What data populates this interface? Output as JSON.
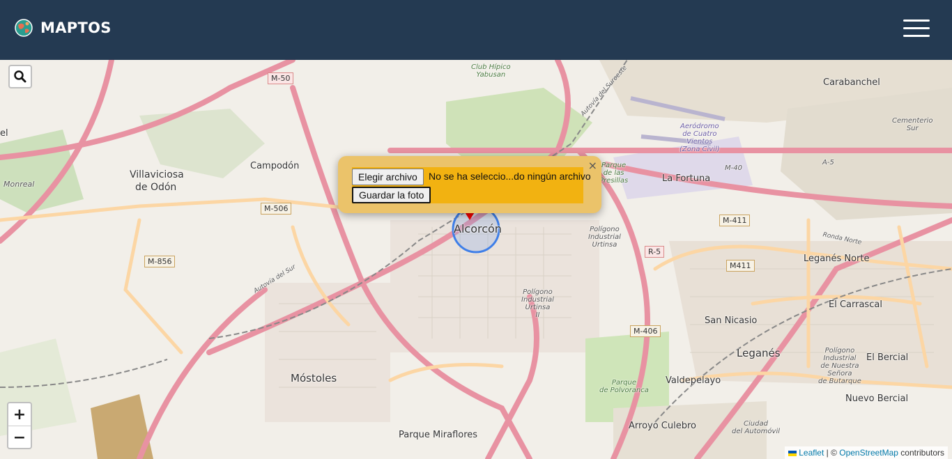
{
  "navbar": {
    "brand": "MAPTOS"
  },
  "map": {
    "places": {
      "alcorcon": "Alcorcón",
      "mostoles": "Móstoles",
      "leganes": "Leganés",
      "leganes_norte": "Leganés Norte",
      "carabanchel": "Carabanchel",
      "villaviciosa": "Villaviciosa",
      "de_odon": "de Odón",
      "campodon": "Campodón",
      "la_fortuna": "La Fortuna",
      "san_nicasio": "San Nicasio",
      "el_carrascal": "El Carrascal",
      "el_bercial": "El Bercial",
      "nuevo_bercial": "Nuevo Bercial",
      "valdepelayo": "Valdepelayo",
      "arroyo_culebro": "Arroyo Culebro",
      "parque_miraflores": "Parque Miraflores",
      "club_hipico_1": "Club Hípico",
      "club_hipico_2": "Yabusan",
      "aerodromo_1": "Aeródromo",
      "aerodromo_2": "de Cuatro",
      "aerodromo_3": "Vientos",
      "aerodromo_4": "(Zona Civil)",
      "cementerio_1": "Cementerio",
      "cementerio_2": "Sur",
      "poligono_urtinsa_1": "Polígono",
      "poligono_urtinsa_2": "Industrial",
      "poligono_urtinsa_3": "Urtinsa",
      "poligono_urtinsa2_1": "Polígono",
      "poligono_urtinsa2_2": "Industrial",
      "poligono_urtinsa2_3": "Urtinsa",
      "poligono_urtinsa2_4": "II",
      "poligono_butarque_1": "Polígono",
      "poligono_butarque_2": "Industrial",
      "poligono_butarque_3": "de Nuestra",
      "poligono_butarque_4": "Señora",
      "poligono_butarque_5": "de Butarque",
      "parque_presillas_1": "Parque",
      "parque_presillas_2": "de las",
      "parque_presillas_3": "Presillas",
      "parque_polvoranca_1": "Parque",
      "parque_polvoranca_2": "de Polvoranca",
      "ciudad_automovil_1": "Ciudad",
      "ciudad_automovil_2": "del Automóvil",
      "monreal": "Monreal",
      "el": "el",
      "ronda_norte": "Ronda Norte",
      "autovia_suroeste": "Autovía del Suroeste",
      "autovia_sur": "Autovía del Sur"
    },
    "shields": {
      "m50": "M-50",
      "m506": "M-506",
      "m856": "M-856",
      "m411": "M-411",
      "m411b": "M411",
      "r5": "R-5",
      "m406": "M-406",
      "m40": "M-40",
      "a5": "A-5"
    },
    "search_icon": "search-icon",
    "zoom_in": "+",
    "zoom_out": "−",
    "attribution": {
      "leaflet": "Leaflet",
      "sep": " | © ",
      "osm": "OpenStreetMap",
      "contributors": " contributors"
    }
  },
  "popup": {
    "close": "×",
    "file_button": "Elegir archivo",
    "file_status": "No se ha seleccio...do ningún archivo",
    "save_button": "Guardar la foto"
  },
  "colors": {
    "navbar": "#243a52",
    "popup_bg": "#ebc36a",
    "popup_inner": "#f2b211",
    "motorway": "#e892a2",
    "primary": "#fcd6a4"
  }
}
